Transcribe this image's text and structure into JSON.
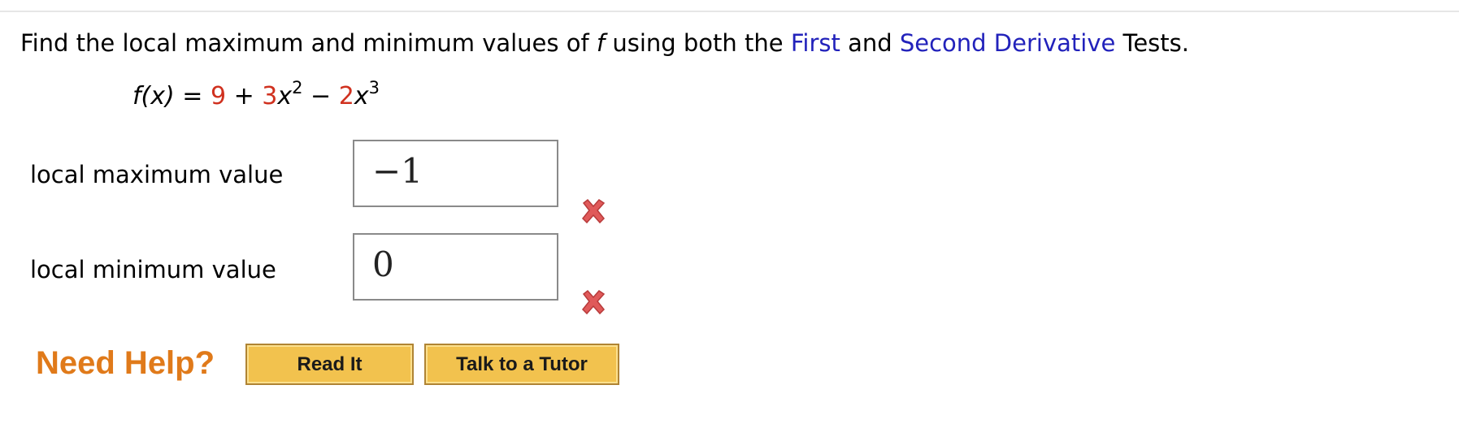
{
  "question": {
    "text_before": "Find the local maximum and minimum values of ",
    "func_name": "f",
    "text_middle": " using both the ",
    "link_first": "First",
    "text_and": " and ",
    "link_second": "Second Derivative",
    "text_after": " Tests."
  },
  "formula": {
    "lhs": "f(x)",
    "eq": " = ",
    "const": "9",
    "plus": " + ",
    "coef2": "3",
    "var2": "x",
    "exp2": "2",
    "minus": " − ",
    "coef3": "2",
    "var3": "x",
    "exp3": "3"
  },
  "fields": {
    "max_label": "local maximum value",
    "max_value": "−1",
    "max_status_icon": "wrong-x-icon",
    "min_label": "local minimum value",
    "min_value": "0",
    "min_status_icon": "wrong-x-icon"
  },
  "help": {
    "label": "Need Help?",
    "read_it": "Read It",
    "talk_tutor": "Talk to a Tutor"
  },
  "colors": {
    "link": "#2222bb",
    "formula_accent": "#d0311f",
    "help_label": "#e07a1a",
    "button_fill": "#f2c24e",
    "wrong_mark": "#e05a5a"
  }
}
